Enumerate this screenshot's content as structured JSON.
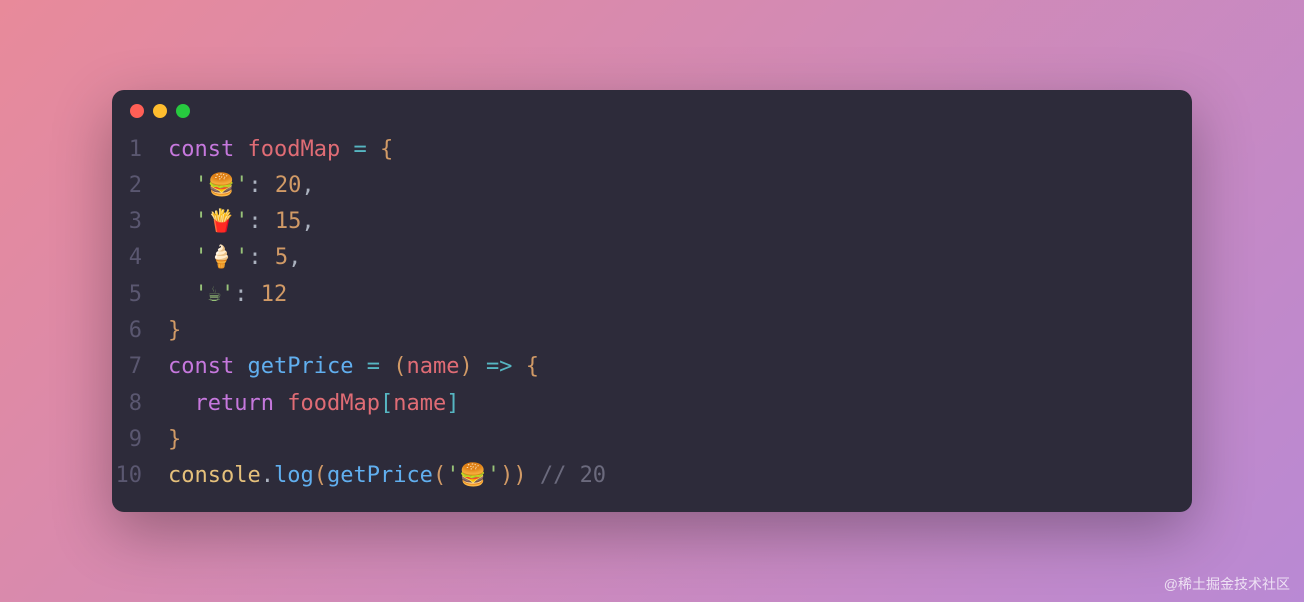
{
  "watermark": "@稀土掘金技术社区",
  "code": {
    "lines": [
      {
        "num": "1",
        "tokens": [
          {
            "cls": "tok-keyword",
            "t": "const"
          },
          {
            "cls": "",
            "t": " "
          },
          {
            "cls": "tok-identifier",
            "t": "foodMap"
          },
          {
            "cls": "",
            "t": " "
          },
          {
            "cls": "tok-operator",
            "t": "="
          },
          {
            "cls": "",
            "t": " "
          },
          {
            "cls": "tok-brace",
            "t": "{"
          }
        ]
      },
      {
        "num": "2",
        "tokens": [
          {
            "cls": "",
            "t": "  "
          },
          {
            "cls": "tok-string",
            "t": "'🍔'"
          },
          {
            "cls": "tok-punct",
            "t": ":"
          },
          {
            "cls": "",
            "t": " "
          },
          {
            "cls": "tok-number",
            "t": "20"
          },
          {
            "cls": "tok-punct",
            "t": ","
          }
        ]
      },
      {
        "num": "3",
        "tokens": [
          {
            "cls": "",
            "t": "  "
          },
          {
            "cls": "tok-string",
            "t": "'🍟'"
          },
          {
            "cls": "tok-punct",
            "t": ":"
          },
          {
            "cls": "",
            "t": " "
          },
          {
            "cls": "tok-number",
            "t": "15"
          },
          {
            "cls": "tok-punct",
            "t": ","
          }
        ]
      },
      {
        "num": "4",
        "tokens": [
          {
            "cls": "",
            "t": "  "
          },
          {
            "cls": "tok-string",
            "t": "'🍦'"
          },
          {
            "cls": "tok-punct",
            "t": ":"
          },
          {
            "cls": "",
            "t": " "
          },
          {
            "cls": "tok-number",
            "t": "5"
          },
          {
            "cls": "tok-punct",
            "t": ","
          }
        ]
      },
      {
        "num": "5",
        "tokens": [
          {
            "cls": "",
            "t": "  "
          },
          {
            "cls": "tok-string",
            "t": "'☕'"
          },
          {
            "cls": "tok-punct",
            "t": ":"
          },
          {
            "cls": "",
            "t": " "
          },
          {
            "cls": "tok-number",
            "t": "12"
          }
        ]
      },
      {
        "num": "6",
        "tokens": [
          {
            "cls": "tok-brace",
            "t": "}"
          }
        ]
      },
      {
        "num": "7",
        "tokens": [
          {
            "cls": "tok-keyword",
            "t": "const"
          },
          {
            "cls": "",
            "t": " "
          },
          {
            "cls": "tok-func",
            "t": "getPrice"
          },
          {
            "cls": "",
            "t": " "
          },
          {
            "cls": "tok-operator",
            "t": "="
          },
          {
            "cls": "",
            "t": " "
          },
          {
            "cls": "tok-brace",
            "t": "("
          },
          {
            "cls": "tok-param",
            "t": "name"
          },
          {
            "cls": "tok-brace",
            "t": ")"
          },
          {
            "cls": "",
            "t": " "
          },
          {
            "cls": "tok-operator",
            "t": "=>"
          },
          {
            "cls": "",
            "t": " "
          },
          {
            "cls": "tok-brace",
            "t": "{"
          }
        ]
      },
      {
        "num": "8",
        "tokens": [
          {
            "cls": "",
            "t": "  "
          },
          {
            "cls": "tok-keyword",
            "t": "return"
          },
          {
            "cls": "",
            "t": " "
          },
          {
            "cls": "tok-identifier",
            "t": "foodMap"
          },
          {
            "cls": "tok-bracket",
            "t": "["
          },
          {
            "cls": "tok-param",
            "t": "name"
          },
          {
            "cls": "tok-bracket",
            "t": "]"
          }
        ]
      },
      {
        "num": "9",
        "tokens": [
          {
            "cls": "tok-brace",
            "t": "}"
          }
        ]
      },
      {
        "num": "10",
        "tokens": [
          {
            "cls": "tok-const",
            "t": "console"
          },
          {
            "cls": "tok-punct",
            "t": "."
          },
          {
            "cls": "tok-func",
            "t": "log"
          },
          {
            "cls": "tok-brace",
            "t": "("
          },
          {
            "cls": "tok-func",
            "t": "getPrice"
          },
          {
            "cls": "tok-brace",
            "t": "("
          },
          {
            "cls": "tok-string",
            "t": "'🍔'"
          },
          {
            "cls": "tok-brace",
            "t": ")"
          },
          {
            "cls": "tok-brace",
            "t": ")"
          },
          {
            "cls": "",
            "t": " "
          },
          {
            "cls": "tok-comment",
            "t": "// 20"
          }
        ]
      }
    ]
  }
}
